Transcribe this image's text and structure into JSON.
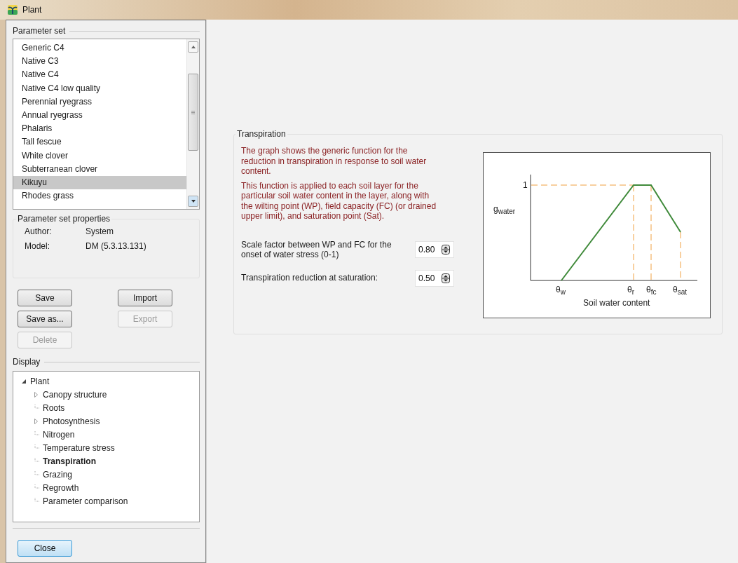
{
  "window": {
    "title": "Plant"
  },
  "parameter_set": {
    "title": "Parameter set",
    "items": [
      {
        "label": "Generic C4",
        "selected": false
      },
      {
        "label": "Native C3",
        "selected": false
      },
      {
        "label": "Native C4",
        "selected": false
      },
      {
        "label": "Native C4 low quality",
        "selected": false
      },
      {
        "label": "Perennial ryegrass",
        "selected": false
      },
      {
        "label": "Annual ryegrass",
        "selected": false
      },
      {
        "label": "Phalaris",
        "selected": false
      },
      {
        "label": "Tall fescue",
        "selected": false
      },
      {
        "label": "White clover",
        "selected": false
      },
      {
        "label": "Subterranean clover",
        "selected": false
      },
      {
        "label": "Kikuyu",
        "selected": true
      },
      {
        "label": "Rhodes grass",
        "selected": false
      }
    ]
  },
  "properties": {
    "title": "Parameter set properties",
    "rows": [
      {
        "label": "Author:",
        "value": "System"
      },
      {
        "label": "Model:",
        "value": "DM (5.3.13.131)"
      }
    ]
  },
  "buttons": [
    {
      "label": "Save",
      "disabled": false
    },
    {
      "label": "Import",
      "disabled": false
    },
    {
      "label": "Save as...",
      "disabled": false
    },
    {
      "label": "Export",
      "disabled": true
    },
    {
      "label": "Delete",
      "disabled": true
    }
  ],
  "display": {
    "title": "Display",
    "tree": [
      {
        "label": "Plant",
        "kind": "branch",
        "expanded": true,
        "selected": false,
        "children": [
          {
            "label": "Canopy structure",
            "kind": "branch",
            "expanded": false,
            "selected": false
          },
          {
            "label": "Roots",
            "kind": "leaf",
            "selected": false
          },
          {
            "label": "Photosynthesis",
            "kind": "branch",
            "expanded": false,
            "selected": false
          },
          {
            "label": "Nitrogen",
            "kind": "leaf",
            "selected": false
          },
          {
            "label": "Temperature stress",
            "kind": "leaf",
            "selected": false
          },
          {
            "label": "Transpiration",
            "kind": "leaf",
            "selected": true
          },
          {
            "label": "Grazing",
            "kind": "leaf",
            "selected": false
          },
          {
            "label": "Regrowth",
            "kind": "leaf",
            "selected": false
          },
          {
            "label": "Parameter comparison",
            "kind": "leaf",
            "selected": false
          }
        ]
      }
    ]
  },
  "close_button": "Close",
  "transpiration": {
    "title": "Transpiration",
    "paragraphs": [
      "The graph shows the generic function for the reduction in transpiration in response to soil water content.",
      "This function is applied to each soil layer for the particular soil water content in the layer, along with the wilting point (WP), field capacity (FC) (or drained upper limit), and saturation point (Sat)."
    ],
    "fields": [
      {
        "label": "Scale factor between WP and FC for the onset of water stress (0-1)",
        "value": "0.80"
      },
      {
        "label": "Transpiration reduction at saturation:",
        "value": "0.50"
      }
    ],
    "graph": {
      "y_tick": "1",
      "y_label": "g$_{water}$",
      "x_markers": [
        "θ$_{w}$",
        "θ$_{r}$",
        "θ$_{fc}$",
        "θ$_{sat}$"
      ],
      "x_label": "Soil water content"
    }
  }
}
